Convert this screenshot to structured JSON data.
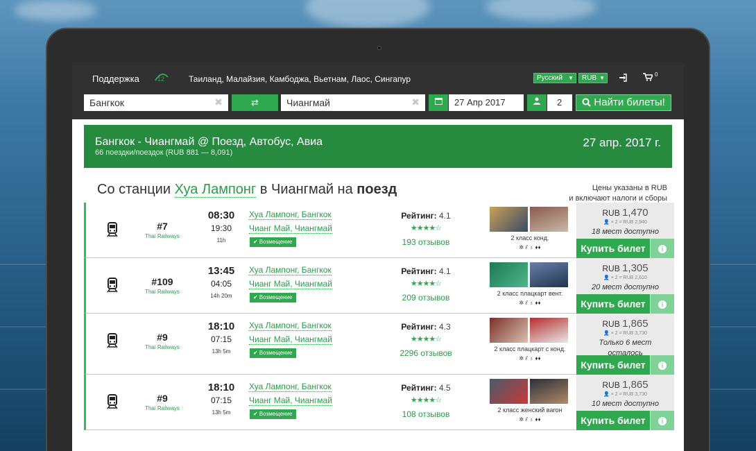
{
  "nav": {
    "support": "Поддержка",
    "logo_text": "12",
    "countries": "Таиланд, Малайзия, Камбоджа, Вьетнам, Лаос, Сингапур",
    "language": "Русский",
    "currency": "RUB",
    "cart_count": "0"
  },
  "search": {
    "from": "Бангкок",
    "to": "Чиангмай",
    "date": "27 Апр 2017",
    "passengers": "2",
    "button": "Найти билеты!"
  },
  "banner": {
    "title": "Бангкок - Чиангмай @ Поезд, Автобус, Авиа",
    "subtitle": "66 поездки/поездок (RUB 881 — 8,091)",
    "date": "27 апр. 2017 г."
  },
  "section": {
    "prefix": "Со станции",
    "station": "Хуа Лампонг",
    "middle": "в Чиангмай на",
    "mode": "поезд",
    "note_line1": "Цены указаны в RUB",
    "note_line2": "и включают налоги и сборы"
  },
  "labels": {
    "refund": "✔ Возмещение",
    "rating": "Рейтинг:",
    "buy": "Купить билет",
    "info": "i",
    "currency_prefix": "RUB",
    "amenities": "✲ ⫽ ♁ ♦♦"
  },
  "colors": {
    "brand_green": "#2fa84f",
    "banner_green": "#268a3f",
    "link_green": "#2a9b48"
  },
  "trips": [
    {
      "number": "#7",
      "carrier": "Thai Railways",
      "departure": "08:30",
      "arrival": "19:30",
      "duration": "11h",
      "from": "Хуа Лампонг, Бангкок",
      "to": "Чианг Май, Чиангмай",
      "rating": "4.1",
      "stars": "★★★★☆",
      "reviews": "193 отзывов",
      "class_name": "2 класс конд.",
      "price": "1,470",
      "calc": "👤 × 2 = RUB 2,940",
      "availability": "18 мест доступно"
    },
    {
      "number": "#109",
      "carrier": "Thai Railways",
      "departure": "13:45",
      "arrival": "04:05",
      "duration": "14h 20m",
      "from": "Хуа Лампонг, Бангкок",
      "to": "Чианг Май, Чиангмай",
      "rating": "4.1",
      "stars": "★★★★☆",
      "reviews": "209 отзывов",
      "class_name": "2 класс плацкарт вент.",
      "price": "1,305",
      "calc": "👤 × 2 = RUB 2,610",
      "availability": "20 мест доступно"
    },
    {
      "number": "#9",
      "carrier": "Thai Railways",
      "departure": "18:10",
      "arrival": "07:15",
      "duration": "13h 5m",
      "from": "Хуа Лампонг, Бангкок",
      "to": "Чианг Май, Чиангмай",
      "rating": "4.3",
      "stars": "★★★★☆",
      "reviews": "2296 отзывов",
      "class_name": "2 класс плацкарт с конд.",
      "price": "1,865",
      "calc": "👤 × 2 = RUB 3,730",
      "availability": "Только 6 мест осталось"
    },
    {
      "number": "#9",
      "carrier": "Thai Railways",
      "departure": "18:10",
      "arrival": "07:15",
      "duration": "13h 5m",
      "from": "Хуа Лампонг, Бангкок",
      "to": "Чианг Май, Чиангмай",
      "rating": "4.5",
      "stars": "★★★★☆",
      "reviews": "108 отзывов",
      "class_name": "2 класс женский вагон",
      "price": "1,865",
      "calc": "👤 × 2 = RUB 3,730",
      "availability": "10 мест доступно"
    }
  ]
}
